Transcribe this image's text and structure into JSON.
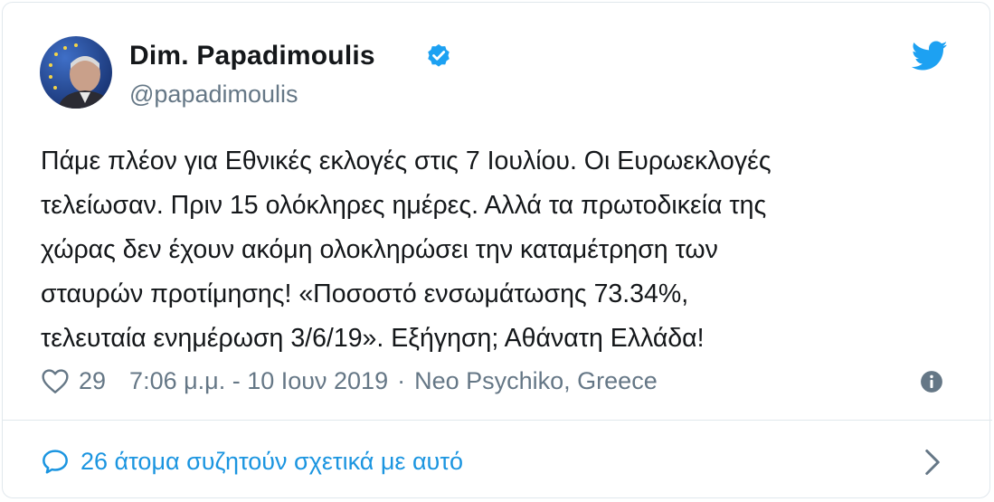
{
  "tweet": {
    "author_name": "Dim. Papadimoulis",
    "author_handle": "@papadimoulis",
    "verified": true,
    "text": "Πάμε πλέον για Εθνικές εκλογές στις 7 Ιουλίου. Οι Ευρωεκλογές\nτελείωσαν. Πριν 15 ολόκληρες ημέρες. Αλλά τα πρωτοδικεία της\nχώρας δεν έχουν ακόμη ολοκληρώσει την καταμέτρηση των\nσταυρών προτίμησης! «Ποσοστό ενσωμάτωσης 73.34%,\nτελευταία ενημέρωση 3/6/19». Εξήγηση; Αθάνατη Ελλάδα!",
    "likes": "29",
    "timestamp": "7:06 μ.μ. - 10 Ιουν 2019",
    "separator": "·",
    "location": "Neo Psychiko, Greece",
    "discussion_link": "26 άτομα συζητούν σχετικά με αυτό"
  },
  "icons": {
    "verified": "verified-badge-icon",
    "bird": "twitter-bird-icon",
    "heart": "heart-icon",
    "info": "info-icon",
    "bubble": "comment-bubble-icon",
    "chevron": "chevron-right-icon"
  },
  "colors": {
    "accent": "#1da1f2",
    "link": "#1b95e0",
    "muted": "#657786",
    "text": "#14171a",
    "border": "#e1e8ed"
  }
}
